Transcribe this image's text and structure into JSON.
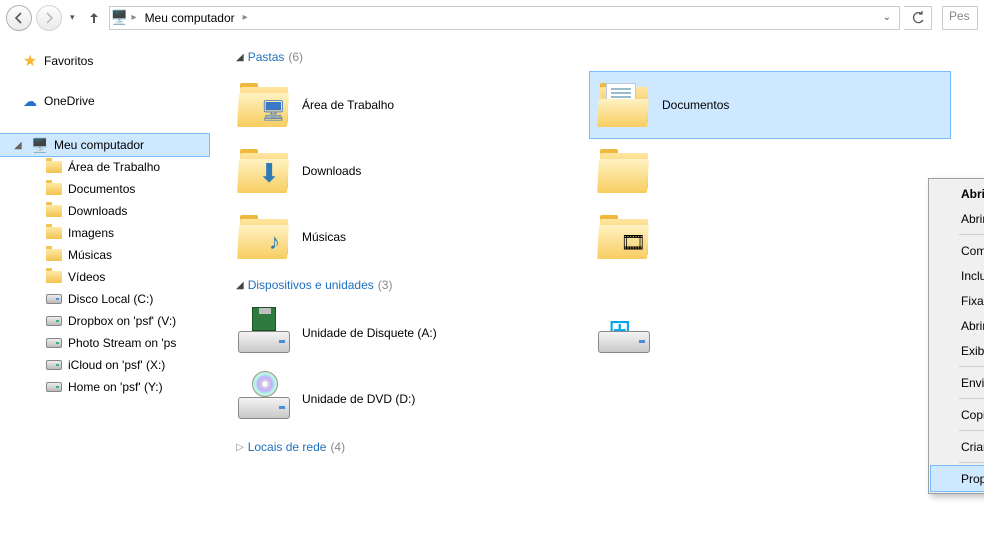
{
  "toolbar": {
    "breadcrumb_root_icon": "computer",
    "breadcrumb": "Meu computador",
    "search_placeholder": "Pes"
  },
  "sidebar": {
    "favorites": "Favoritos",
    "onedrive": "OneDrive",
    "computer": "Meu computador",
    "items": [
      "Área de Trabalho",
      "Documentos",
      "Downloads",
      "Imagens",
      "Músicas",
      "Vídeos",
      "Disco Local (C:)",
      "Dropbox on 'psf' (V:)",
      "Photo Stream on 'ps",
      "iCloud on 'psf' (X:)",
      "Home on 'psf' (Y:)"
    ]
  },
  "sections": {
    "folders": {
      "title": "Pastas",
      "count": "(6)"
    },
    "devices": {
      "title": "Dispositivos e unidades",
      "count": "(3)"
    },
    "network": {
      "title": "Locais de rede",
      "count": "(4)"
    }
  },
  "folders": [
    "Área de Trabalho",
    "Documentos",
    "Downloads",
    "Músicas"
  ],
  "devices": [
    "Unidade de Disquete (A:)",
    "Unidade de DVD (D:)"
  ],
  "context_menu": {
    "open": "Abrir",
    "open_new": "Abrir em nova janela",
    "share": "Compartilhar com",
    "library": "Incluir na biblioteca",
    "pin": "Fixar na Tela Inicial",
    "open_mac": "Abrir no Mac",
    "finder": "Exibir no Finder",
    "send_to": "Enviar para",
    "copy": "Copiar",
    "shortcut": "Criar atalho",
    "properties": "Propriedades"
  }
}
